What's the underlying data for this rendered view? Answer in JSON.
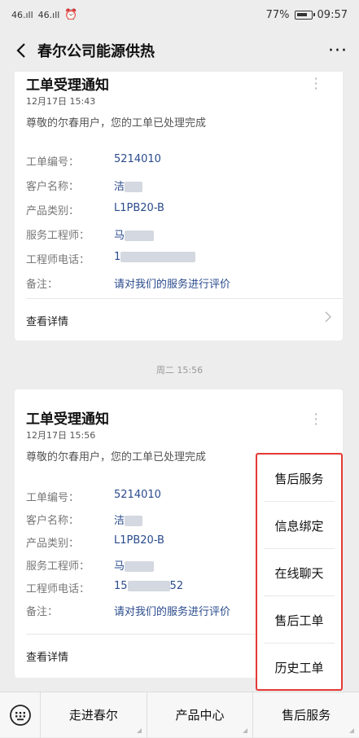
{
  "status": {
    "signal1": "46.ıll",
    "signal2": "46.ıll",
    "battery_pct": "77%",
    "time": "09:57"
  },
  "nav": {
    "title": "春尔公司能源供热",
    "more": "···"
  },
  "card1": {
    "title": "工单受理通知",
    "date": "12月17日  15:43",
    "desc": "尊敬的尔春用户，您的工单已处理完成",
    "rows": [
      {
        "label": "工单编号：",
        "value": "5214010"
      },
      {
        "label": "客户名称：",
        "value": "洁"
      },
      {
        "label": "产品类别：",
        "value": "L1PB20-B"
      },
      {
        "label": "服务工程师：",
        "value": "马"
      },
      {
        "label": "工程师电话：",
        "value": "1"
      },
      {
        "label": "备注：",
        "value": "请对我们的服务进行评价"
      }
    ],
    "detail": "查看详情"
  },
  "separator_time": "周二 15:56",
  "card2": {
    "title": "工单受理通知",
    "date": "12月17日  15:56",
    "desc": "尊敬的尔春用户，您的工单已处理完成",
    "rows": [
      {
        "label": "工单编号：",
        "value": "5214010"
      },
      {
        "label": "客户名称：",
        "value": "洁"
      },
      {
        "label": "产品类别：",
        "value": "L1PB20-B"
      },
      {
        "label": "服务工程师：",
        "value": "马"
      },
      {
        "label": "工程师电话：",
        "value": "15",
        "suffix": "52"
      },
      {
        "label": "备注：",
        "value": "请对我们的服务进行评价"
      }
    ],
    "detail": "查看详情"
  },
  "popup_menu": {
    "items": [
      "售后服务",
      "信息绑定",
      "在线聊天",
      "售后工单",
      "历史工单"
    ],
    "border_color": "#e53935"
  },
  "bottom_menu": {
    "items": [
      "走进春尔",
      "产品中心",
      "售后服务"
    ]
  },
  "colors": {
    "link": "#2a4b8d",
    "background": "#ededed",
    "highlight": "#e53935"
  }
}
